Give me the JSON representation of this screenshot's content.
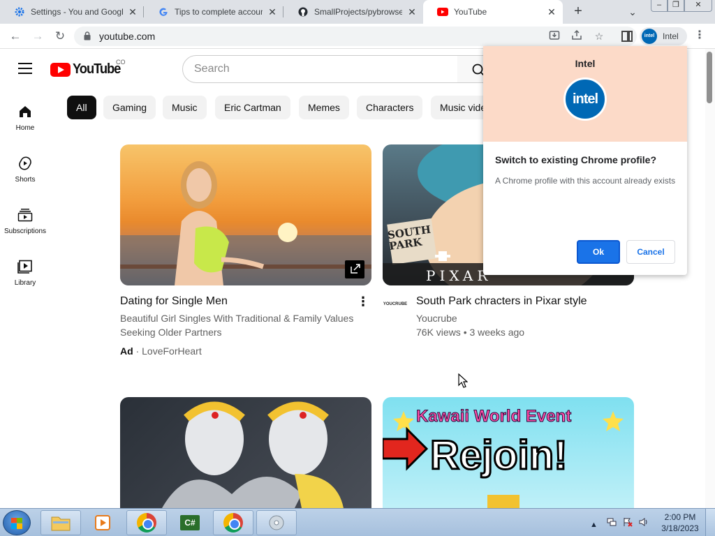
{
  "browser": {
    "tabs": [
      {
        "title": "Settings - You and Google",
        "icon": "gear-icon"
      },
      {
        "title": "Tips to complete account",
        "icon": "google-icon"
      },
      {
        "title": "SmallProjects/pybrowser",
        "icon": "github-icon"
      },
      {
        "title": "YouTube",
        "icon": "youtube-icon"
      }
    ],
    "url": "youtube.com",
    "profile_name": "Intel",
    "profile_badge": "intel"
  },
  "youtube": {
    "logo_text": "YouTube",
    "country_code": "CO",
    "search_placeholder": "Search",
    "sidebar": [
      {
        "label": "Home",
        "icon": "home-icon"
      },
      {
        "label": "Shorts",
        "icon": "shorts-icon"
      },
      {
        "label": "Subscriptions",
        "icon": "subscriptions-icon"
      },
      {
        "label": "Library",
        "icon": "library-icon"
      }
    ],
    "chips": [
      "All",
      "Gaming",
      "Music",
      "Eric Cartman",
      "Memes",
      "Characters",
      "Music vide"
    ],
    "videos": [
      {
        "title": "Dating for Single Men",
        "description_line1": "Beautiful Girl Singles With Traditional & Family Values",
        "description_line2": "Seeking Older Partners",
        "ad_label": "Ad",
        "advertiser": "LoveForHeart"
      },
      {
        "title": "South Park chracters in Pixar style",
        "channel": "Youcrube",
        "stats": "76K views • 3 weeks ago",
        "thumb_sign": "SOUTH PARK",
        "thumb_brand": "PIXAR",
        "avatar_text": "YOUCRUBE"
      },
      {
        "title": "",
        "thumb": "robot-twins"
      },
      {
        "title": "",
        "thumb_line1": "Kawaii World Event",
        "thumb_line2": "Rejoin!"
      }
    ]
  },
  "dialog": {
    "profile_name": "Intel",
    "badge_text": "intel",
    "title": "Switch to existing Chrome profile?",
    "body": "A Chrome profile with this account already exists",
    "ok_label": "Ok",
    "cancel_label": "Cancel",
    "header_color": "#fcdac8"
  },
  "taskbar": {
    "time": "2:00 PM",
    "date": "3/18/2023",
    "csharp_label": "C#"
  }
}
